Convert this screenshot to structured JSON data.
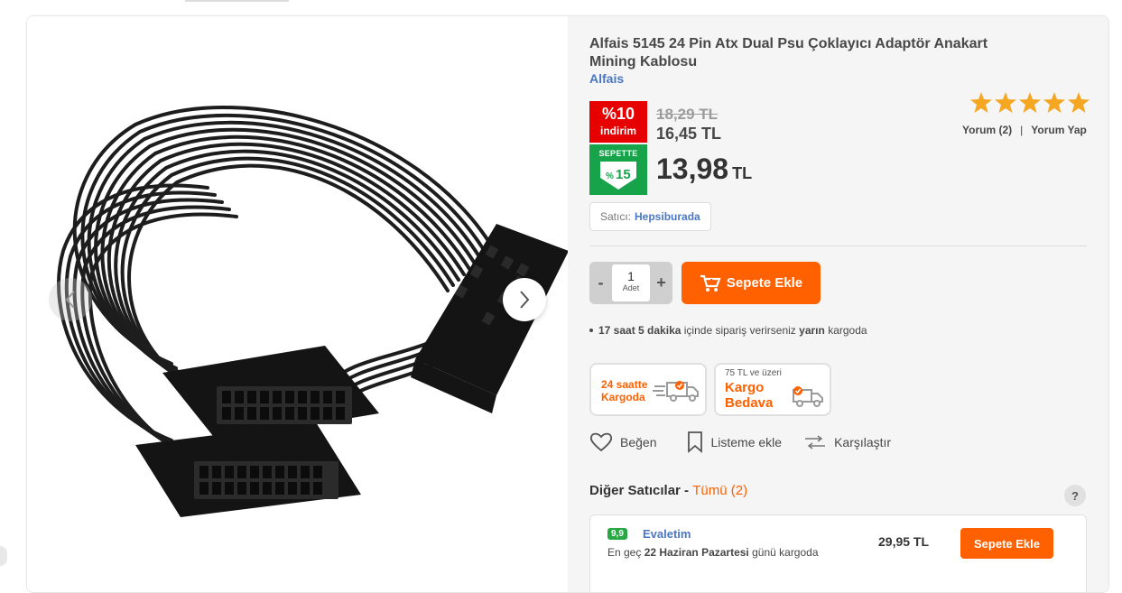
{
  "product": {
    "title": "Alfais 5145 24 Pin Atx Dual Psu Çoklayıcı Adaptör Anakart Mining Kablosu",
    "brand": "Alfais"
  },
  "pricing": {
    "discount_pct": "%10",
    "discount_label": "indirim",
    "old_price": "18,29 TL",
    "mid_price": "16,45 TL",
    "cart_label": "SEPETTE",
    "cart_pct_symbol": "%",
    "cart_pct": "15",
    "final_price": "13,98",
    "final_currency": "TL"
  },
  "rating": {
    "stars": 5,
    "star_color": "#f5a623",
    "reviews": "Yorum (2)",
    "separator": "|",
    "write_review": "Yorum Yap"
  },
  "seller": {
    "label": "Satıcı:",
    "name": "Hepsiburada"
  },
  "quantity": {
    "minus": "-",
    "value": "1",
    "unit": "Adet",
    "plus": "+"
  },
  "cart_button": "Sepete Ekle",
  "delivery_note": {
    "hours": "17 saat",
    "minutes": "5 dakika",
    "mid": "içinde sipariş verirseniz",
    "day": "yarın",
    "tail": "kargoda"
  },
  "shipping": {
    "fast_line1": "24 saatte",
    "fast_line2": "Kargoda",
    "free_small": "75 TL ve üzeri",
    "free_line1": "Kargo",
    "free_line2": "Bedava"
  },
  "actions": {
    "like": "Beğen",
    "list": "Listeme ekle",
    "compare": "Karşılaştır"
  },
  "other_sellers": {
    "title": "Diğer Satıcılar -",
    "all": "Tümü (2)",
    "help": "?",
    "offers": [
      {
        "score": "9,9",
        "name": "Evaletim",
        "eta_pre": "En geç",
        "eta_date": "22 Haziran Pazartesi",
        "eta_post": "günü kargoda",
        "price": "29,95 TL",
        "button": "Sepete Ekle"
      }
    ]
  },
  "colors": {
    "accent": "#ff6000",
    "link": "#4a77c4",
    "discount_red": "#e60000",
    "cart_green": "#16a34a"
  }
}
